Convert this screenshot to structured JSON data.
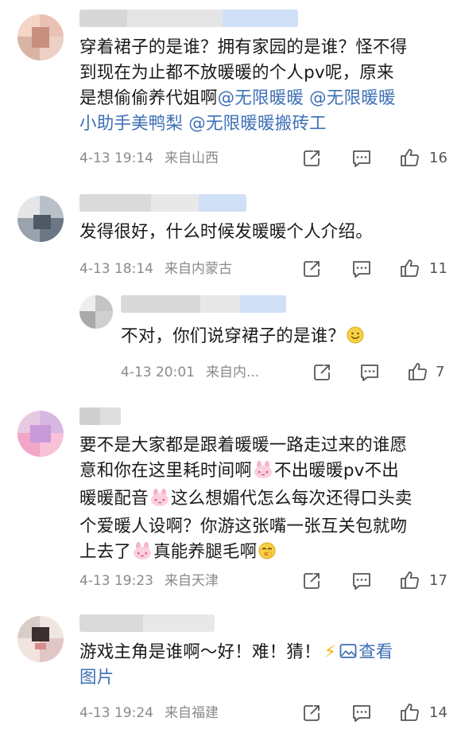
{
  "comments": [
    {
      "body_parts": [
        "穿着裙子的是谁？拥有家园的是谁？怪不得",
        "到现在为止都不放暖暖的个人pv呢，原来",
        "是想偷偷养代姐啊"
      ],
      "mentions": [
        "@无限暖暖",
        "@无限暖暖",
        "小助手美鸭梨",
        "@无限暖暖搬砖工"
      ],
      "time": "4-13 19:14",
      "location": "来自山西",
      "likes": "16"
    },
    {
      "body": "发得很好，什么时候发暖暖个人介绍。",
      "time": "4-13 18:14",
      "location": "来自内蒙古",
      "likes": "11"
    },
    {
      "body": "不对，你们说穿裙子的是谁？",
      "emoji": "🙂",
      "time": "4-13 20:01",
      "location": "来自内...",
      "likes": "7"
    },
    {
      "lines": [
        "要不是大家都是跟着暖暖一路走过来的谁愿",
        "意和你在这里耗时间啊",
        "不出暖暖pv不出",
        "暖暖配音",
        "这么想媚代怎么每次还得口头卖",
        "个爱暖人设啊？你游这张嘴一张互关包就吻",
        "上去了",
        "真能养腿毛啊"
      ],
      "emoji_end": "🤭",
      "time": "4-13 19:23",
      "location": "来自天津",
      "likes": "17"
    },
    {
      "body": "游戏主角是谁啊～好！难！猜！",
      "flash": "⚡",
      "view_image_label": "查看",
      "view_image_label_2": "图片",
      "time": "4-13 19:24",
      "location": "来自福建",
      "likes": "14"
    }
  ],
  "colors": {
    "mention": "#3d6fb5",
    "meta": "#8a8a8a"
  },
  "icons": [
    "share-icon",
    "comment-icon",
    "like-icon",
    "pink-bunny-emoji",
    "smile-emoji",
    "lightning-emoji",
    "image-icon"
  ]
}
